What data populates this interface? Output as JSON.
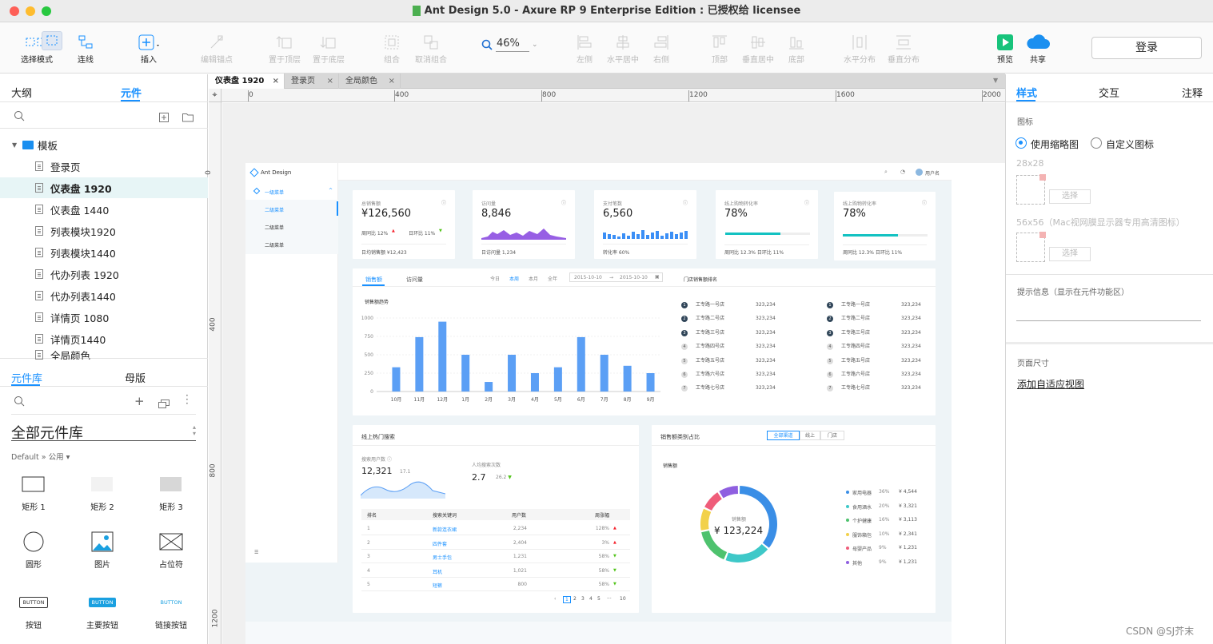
{
  "window": {
    "title": "Ant Design 5.0 - Axure RP 9 Enterprise Edition : 已授权给 licensee"
  },
  "toolbar": {
    "select_mode": "选择模式",
    "connect": "连线",
    "insert": "插入",
    "edit_anchor": "编辑锚点",
    "bring_front": "置于顶层",
    "send_back": "置于底层",
    "group": "组合",
    "ungroup": "取消组合",
    "zoom": "46%",
    "align_left": "左侧",
    "align_hcenter": "水平居中",
    "align_right": "右侧",
    "align_top": "顶部",
    "align_vcenter": "垂直居中",
    "align_bottom": "底部",
    "dist_h": "水平分布",
    "dist_v": "垂直分布",
    "preview": "预览",
    "share": "共享",
    "login": "登录"
  },
  "left_panel": {
    "tab_outline": "大纲",
    "tab_widgets": "元件",
    "folder": "模板",
    "pages": [
      "登录页",
      "仪表盘 1920",
      "仪表盘 1440",
      "列表模块1920",
      "列表模块1440",
      "代办列表 1920",
      "代办列表1440",
      "详情页 1080",
      "详情页1440",
      "全局颜色"
    ],
    "lib_tab": "元件库",
    "master_tab": "母版",
    "library_name": "全部元件库",
    "library_path": "Default » 公用",
    "widgets": [
      "矩形 1",
      "矩形 2",
      "矩形 3",
      "圆形",
      "图片",
      "占位符",
      "按钮",
      "主要按钮",
      "链接按钮"
    ],
    "button_text": "BUTTON"
  },
  "doc_tabs": [
    "仪表盘 1920",
    "登录页",
    "全局颜色"
  ],
  "ruler": {
    "h": [
      "0",
      "400",
      "800",
      "1200",
      "1600",
      "2000"
    ],
    "v": [
      "0",
      "400",
      "800",
      "1200"
    ]
  },
  "right_panel": {
    "tab_style": "样式",
    "tab_interact": "交互",
    "tab_notes": "注释",
    "icon_label": "图标",
    "opt_thumb": "使用缩略图",
    "opt_custom": "自定义图标",
    "size_28": "28x28",
    "size_56": "56x56（Mac视网膜显示器专用高清图标）",
    "select": "选择",
    "tip_label": "提示信息（显示在元件功能区）",
    "page_size": "页面尺寸",
    "adaptive_link": "添加自适应视图"
  },
  "dashboard": {
    "logo": "Ant Design",
    "user": "用户名",
    "menu": [
      "一级菜单",
      "二级菜单",
      "二级菜单",
      "二级菜单"
    ],
    "cards": [
      {
        "title": "总销售额",
        "value": "¥126,560",
        "f1": "周同比  12%",
        "f2": "日环比  11%",
        "foot": "日均销售额 ¥12,423"
      },
      {
        "title": "访问量",
        "value": "8,846",
        "foot": "日访问量  1,234"
      },
      {
        "title": "支付笔数",
        "value": "6,560",
        "foot": "转化率  60%"
      },
      {
        "title": "线上购物转化率",
        "value": "78%",
        "foot": "周同比  12.3%     日环比  11%"
      },
      {
        "title": "线上购物转化率",
        "value": "78%",
        "foot": "周同比  12.3%     日环比  11%"
      }
    ],
    "sales_tabs": [
      "销售额",
      "访问量"
    ],
    "periods": [
      "今日",
      "本周",
      "本月",
      "全年"
    ],
    "date_from": "2015-10-10",
    "date_to": "2015-10-10",
    "trend_title": "销售额趋势",
    "rank_title": "门店销售额排名",
    "rank_rows": [
      [
        "1",
        "工专路一号店",
        "323,234"
      ],
      [
        "2",
        "工专路二号店",
        "323,234"
      ],
      [
        "3",
        "工专路三号店",
        "323,234"
      ],
      [
        "4",
        "工专路四号店",
        "323,234"
      ],
      [
        "5",
        "工专路五号店",
        "323,234"
      ],
      [
        "6",
        "工专路六号店",
        "323,234"
      ],
      [
        "7",
        "工专路七号店",
        "323,234"
      ]
    ],
    "search_title": "线上热门搜索",
    "users_label": "搜索用户数",
    "users_val": "12,321",
    "users_sub": "17.1",
    "avg_label": "人均搜索次数",
    "avg_val": "2.7",
    "avg_sub": "26.2",
    "table_head": [
      "排名",
      "搜索关键词",
      "用户数",
      "周涨幅"
    ],
    "table_rows": [
      [
        "1",
        "新款连衣裙",
        "2,234",
        "128%"
      ],
      [
        "2",
        "四件套",
        "2,404",
        "3%"
      ],
      [
        "3",
        "男士手包",
        "1,231",
        "58%"
      ],
      [
        "4",
        "耳机",
        "1,021",
        "58%"
      ],
      [
        "5",
        "短裤",
        "800",
        "58%"
      ]
    ],
    "pages": [
      "1",
      "2",
      "3",
      "4",
      "5",
      "···",
      "10"
    ],
    "cat_title": "销售额类别占比",
    "cat_tabs": [
      "全部渠道",
      "线上",
      "门店"
    ],
    "cat_sub": "销售额",
    "donut_label": "销售额",
    "donut_value": "¥ 123,224",
    "legend": [
      [
        "家用电器",
        "36%",
        "¥ 4,544"
      ],
      [
        "食用酒水",
        "20%",
        "¥ 3,321"
      ],
      [
        "个护健康",
        "16%",
        "¥ 3,113"
      ],
      [
        "服饰箱包",
        "10%",
        "¥ 2,341"
      ],
      [
        "母婴产品",
        "9%",
        "¥ 1,231"
      ],
      [
        "其他",
        "9%",
        "¥ 1,231"
      ]
    ]
  },
  "watermark": "CSDN @SJ芥末",
  "chart_data": {
    "type": "bar",
    "title": "销售额趋势",
    "categories": [
      "10月",
      "11月",
      "12月",
      "1月",
      "2月",
      "3月",
      "4月",
      "5月",
      "6月",
      "7月",
      "8月",
      "9月"
    ],
    "values": [
      330,
      740,
      950,
      500,
      130,
      500,
      250,
      330,
      740,
      500,
      350,
      250
    ],
    "y_ticks": [
      "1000",
      "750",
      "500",
      "250",
      "0"
    ],
    "ylim": [
      0,
      1000
    ],
    "color": "#5b9ff5"
  }
}
